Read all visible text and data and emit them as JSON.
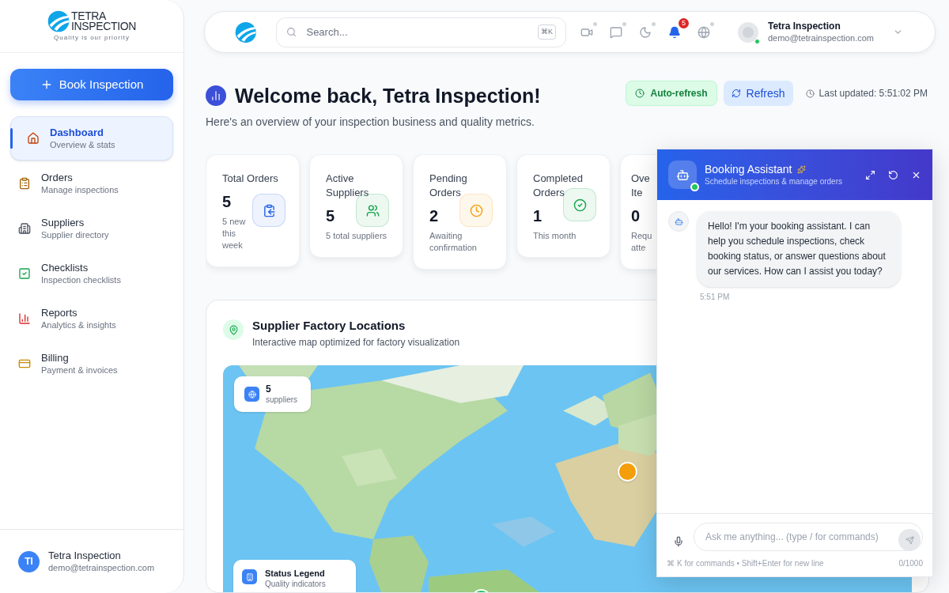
{
  "sidebar": {
    "logo": {
      "line1": "TETRA",
      "line2": "INSPECTION",
      "tagline": "Quality is our priority"
    },
    "book_button": "Book Inspection",
    "items": [
      {
        "label": "Dashboard",
        "sub": "Overview & stats",
        "selected": true
      },
      {
        "label": "Orders",
        "sub": "Manage inspections",
        "selected": false
      },
      {
        "label": "Suppliers",
        "sub": "Supplier directory",
        "selected": false
      },
      {
        "label": "Checklists",
        "sub": "Inspection checklists",
        "selected": false
      },
      {
        "label": "Reports",
        "sub": "Analytics & insights",
        "selected": false
      },
      {
        "label": "Billing",
        "sub": "Payment & invoices",
        "selected": false
      }
    ],
    "user": {
      "initials": "TI",
      "name": "Tetra Inspection",
      "email": "demo@tetrainspection.com"
    }
  },
  "topbar": {
    "search": {
      "placeholder": "Search...",
      "shortcut": "⌘K"
    },
    "notification_count": "5",
    "user": {
      "name": "Tetra Inspection",
      "email": "demo@tetrainspection.com",
      "online": true
    }
  },
  "welcome": {
    "title": "Welcome back, Tetra Inspection!",
    "subtitle": "Here's an overview of your inspection business and quality metrics.",
    "auto_refresh": "Auto-refresh",
    "refresh": "Refresh",
    "last_updated": "Last updated: 5:51:02 PM"
  },
  "stats": [
    {
      "title": "Total Orders",
      "value": "5",
      "note": "5 new this week",
      "color": "#2563eb"
    },
    {
      "title": "Active Suppliers",
      "value": "5",
      "note": "5 total suppliers",
      "color": "#16a34a"
    },
    {
      "title": "Pending Orders",
      "value": "2",
      "note": "Awaiting confirmation",
      "color": "#f59e0b"
    },
    {
      "title": "Completed Orders",
      "value": "1",
      "note": "This month",
      "color": "#16a34a"
    },
    {
      "title_lines": [
        "Ove",
        "Ite"
      ],
      "value": "0",
      "note_lines": [
        "Requ",
        "atte"
      ]
    }
  ],
  "map_card": {
    "title": "Supplier Factory Locations",
    "subtitle": "Interactive map optimized for factory visualization",
    "count": "5",
    "count_label": "suppliers",
    "legend_title": "Status Legend",
    "legend_subtitle": "Quality indicators",
    "markers": [
      {
        "color": "#f59e0b"
      },
      {
        "color": "#22c55e"
      }
    ]
  },
  "chat": {
    "title": "Booking Assistant",
    "subtitle": "Schedule inspections & manage orders",
    "online": true,
    "messages": [
      {
        "text": "Hello! I'm your booking assistant. I can help you schedule inspections, check booking status, or answer questions about our services. How can I assist you today?",
        "time": "5:51 PM"
      }
    ],
    "placeholder": "Ask me anything... (type / for commands)",
    "hint_key": "⌘",
    "hint": "K for commands • Shift+Enter for new line",
    "counter": "0/1000"
  }
}
